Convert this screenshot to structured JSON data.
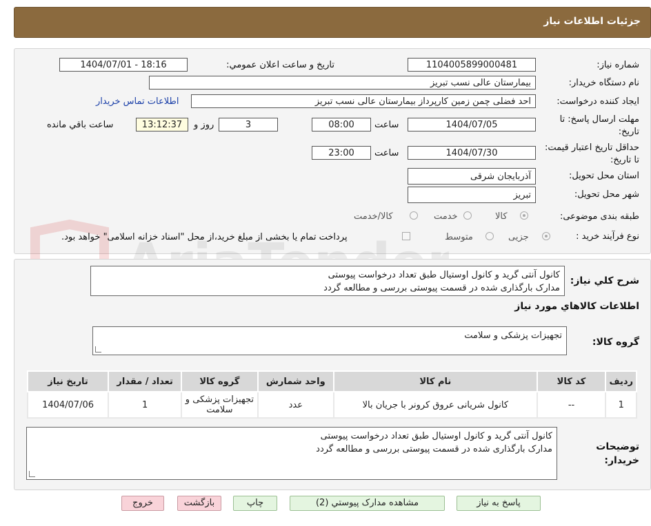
{
  "header": {
    "title": "جزئیات اطلاعات نیاز"
  },
  "watermark": {
    "text": "AriaTender.neT"
  },
  "form": {
    "need_number": {
      "label": "شماره نیاز:",
      "value": "1104005899000481"
    },
    "announce_datetime": {
      "label": "تاریخ و ساعت اعلان عمومي:",
      "value": "1404/07/01 - 18:16"
    },
    "buyer_org": {
      "label": "نام دستگاه خریدار:",
      "value": "بیمارستان عالی نسب تبریز"
    },
    "requester": {
      "label": "ایجاد کننده درخواست:",
      "value": "احد فضلی چمن زمین کارپرداز  بیمارستان عالی نسب تبریز"
    },
    "contact_link": "اطلاعات تماس خریدار",
    "deadline": {
      "label": "مهلت ارسال پاسخ: تا تاریخ:",
      "date": "1404/07/05",
      "time_label": "ساعت",
      "time": "08:00",
      "days": "3",
      "days_label": "روز و",
      "remaining": "13:12:37",
      "remaining_label": "ساعت باقي مانده"
    },
    "validity": {
      "label": "حداقل تاریخ اعتبار قیمت: تا تاریخ:",
      "date": "1404/07/30",
      "time_label": "ساعت",
      "time": "23:00"
    },
    "province": {
      "label": "استان محل تحویل:",
      "value": "آذربایجان شرقی"
    },
    "city": {
      "label": "شهر محل تحویل:",
      "value": "تبریز"
    },
    "category": {
      "label": "طبقه بندی موضوعی:",
      "options": [
        "کالا",
        "خدمت",
        "کالا/خدمت"
      ],
      "selected": "کالا"
    },
    "purchase_type": {
      "label": "نوع فرآیند خرید :",
      "options": [
        "جزیی",
        "متوسط"
      ],
      "selected": "جزیی",
      "note": "پرداخت تمام یا بخشی از مبلغ خرید،از محل \"اسناد خزانه اسلامی\" خواهد بود."
    }
  },
  "description": {
    "label": "شرح کلي نیاز:",
    "line1": "کانول آنتی گرید و کانول اوستیال طبق تعداد درخواست پیوستی",
    "line2": "مدارک بارگذاری شده در قسمت پیوستی بررسی و مطالعه گردد"
  },
  "goods_info": {
    "title": "اطلاعات کالاهاي مورد نیاز",
    "group_label": "گروه کالا:",
    "group_value": "تجهیزات پزشکی و سلامت"
  },
  "table": {
    "headers": [
      "ردیف",
      "کد کالا",
      "نام کالا",
      "واحد شمارش",
      "گروه کالا",
      "تعداد / مقدار",
      "تاریخ نیاز"
    ],
    "rows": [
      [
        "1",
        "--",
        "کانول شریانی عروق کرونر با جریان بالا",
        "عدد",
        "تجهیزات پزشکی و سلامت",
        "1",
        "1404/07/06"
      ]
    ]
  },
  "buyer_notes": {
    "label": "توضیحات خریدار:",
    "line1": "کانول آنتی گرید و کانول اوستیال طبق تعداد درخواست پیوستی",
    "line2": "مدارک بارگذاری شده در قسمت پیوستی بررسی و مطالعه گردد"
  },
  "buttons": {
    "reply": "پاسخ به نیاز",
    "attachments": "مشاهده مدارک پیوستي (2)",
    "print": "چاپ",
    "back": "بازگشت",
    "exit": "خروج"
  }
}
